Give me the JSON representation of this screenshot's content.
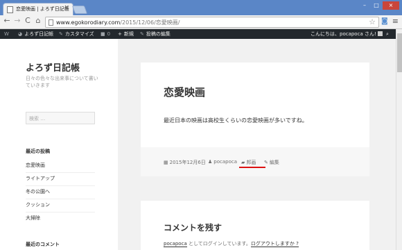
{
  "browser": {
    "tab_title": "恋愛映画 | よろず日記帳",
    "tab_close": "×",
    "window_buttons": [
      "–",
      "□",
      "×"
    ],
    "url_host": "www.egokorodiary.com",
    "url_path": "/2015/12/06/恋愛映画/",
    "nav": {
      "back": "←",
      "forward": "→",
      "reload": "C",
      "home": "⌂"
    },
    "star": "☆",
    "menu": "≡"
  },
  "adminbar": {
    "wp_logo": "W",
    "site_name": "よろず日記帳",
    "customize": "カスタマイズ",
    "comments_count": "0",
    "new": "新規",
    "edit_post": "投稿の編集",
    "greeting": "こんにちは、pocapoca さん!",
    "search_icon": "⌕"
  },
  "sidebar": {
    "site_title": "よろず日記帳",
    "site_description": "日々の色々な出来事について書いていきます",
    "search_placeholder": "検索 …",
    "recent_posts_title": "最近の投稿",
    "recent_posts": [
      "恋愛映画",
      "ライトアップ",
      "冬の公園へ",
      "クッション",
      "大掃除"
    ],
    "recent_comments_title": "最近のコメント"
  },
  "post": {
    "title": "恋愛映画",
    "body": "最近日本の映画は高校生くらいの恋愛映画が多いですね。",
    "date": "2015年12月6日",
    "author": "pocapoca",
    "category": "邦画",
    "edit": "編集"
  },
  "comments": {
    "title": "コメントを残す",
    "logged_in_as_prefix": "pocapoca",
    "logged_in_as_mid": " としてログインしています。",
    "logout": "ログアウトしますか ?"
  },
  "colors": {
    "underline": "#dd1111",
    "adminbar": "#23282d",
    "chrome_frame": "#5a86c7"
  }
}
